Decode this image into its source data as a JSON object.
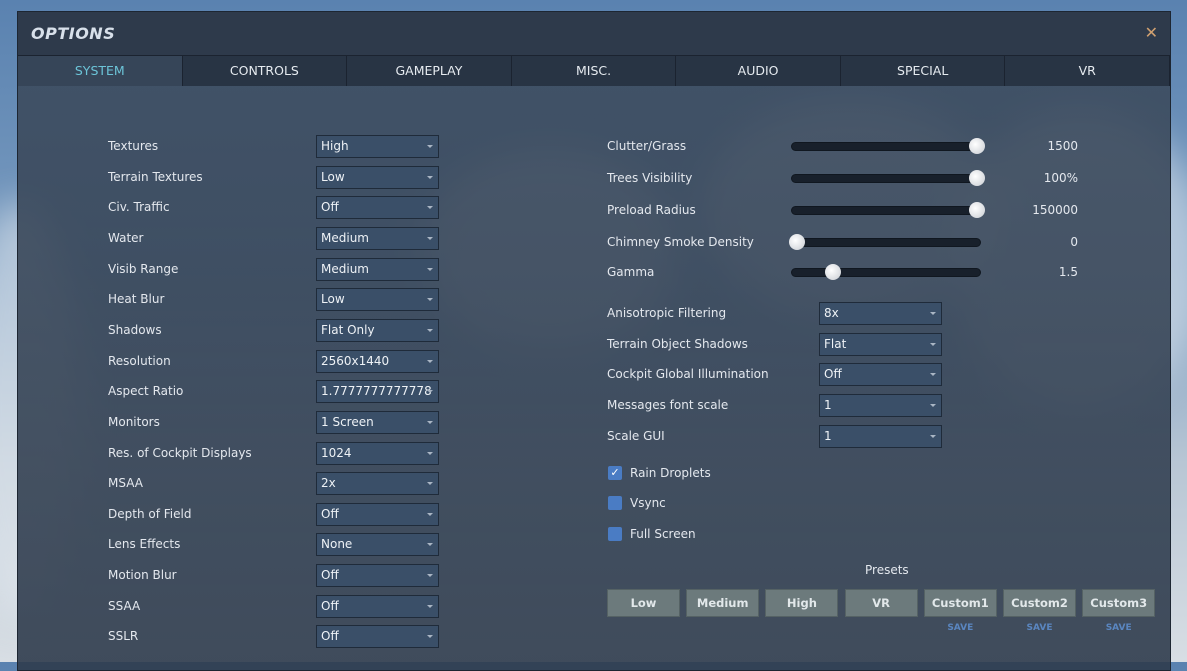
{
  "title": "OPTIONS",
  "tabs": [
    "SYSTEM",
    "CONTROLS",
    "GAMEPLAY",
    "MISC.",
    "AUDIO",
    "SPECIAL",
    "VR"
  ],
  "left": [
    {
      "label": "Textures",
      "value": "High"
    },
    {
      "label": "Terrain Textures",
      "value": "Low"
    },
    {
      "label": "Civ. Traffic",
      "value": "Off"
    },
    {
      "label": "Water",
      "value": "Medium"
    },
    {
      "label": "Visib Range",
      "value": "Medium"
    },
    {
      "label": "Heat Blur",
      "value": "Low"
    },
    {
      "label": "Shadows",
      "value": "Flat Only"
    },
    {
      "label": "Resolution",
      "value": "2560x1440"
    },
    {
      "label": "Aspect Ratio",
      "value": "1.7777777777778"
    },
    {
      "label": "Monitors",
      "value": "1 Screen"
    },
    {
      "label": "Res. of Cockpit Displays",
      "value": "1024"
    },
    {
      "label": "MSAA",
      "value": "2x"
    },
    {
      "label": "Depth of Field",
      "value": "Off"
    },
    {
      "label": "Lens Effects",
      "value": "None"
    },
    {
      "label": "Motion Blur",
      "value": "Off"
    },
    {
      "label": "SSAA",
      "value": "Off"
    },
    {
      "label": "SSLR",
      "value": "Off"
    }
  ],
  "sliders": [
    {
      "label": "Clutter/Grass",
      "value": "1500",
      "fraction": 1.0
    },
    {
      "label": "Trees Visibility",
      "value": "100%",
      "fraction": 1.0
    },
    {
      "label": "Preload Radius",
      "value": "150000",
      "fraction": 1.0
    },
    {
      "label": "Chimney Smoke Density",
      "value": "0",
      "fraction": 0.0
    },
    {
      "label": "Gamma",
      "value": "1.5",
      "fraction": 0.2
    }
  ],
  "right_dropdowns": [
    {
      "label": "Anisotropic Filtering",
      "value": "8x"
    },
    {
      "label": "Terrain Object Shadows",
      "value": "Flat"
    },
    {
      "label": "Cockpit Global Illumination",
      "value": "Off"
    },
    {
      "label": "Messages font scale",
      "value": "1"
    },
    {
      "label": "Scale GUI",
      "value": "1"
    }
  ],
  "checkboxes": [
    {
      "label": "Rain Droplets",
      "checked": true
    },
    {
      "label": "Vsync",
      "checked": false
    },
    {
      "label": "Full Screen",
      "checked": false
    }
  ],
  "presets": {
    "label": "Presets",
    "buttons": [
      "Low",
      "Medium",
      "High",
      "VR",
      "Custom1",
      "Custom2",
      "Custom3"
    ],
    "save_label": "SAVE"
  }
}
